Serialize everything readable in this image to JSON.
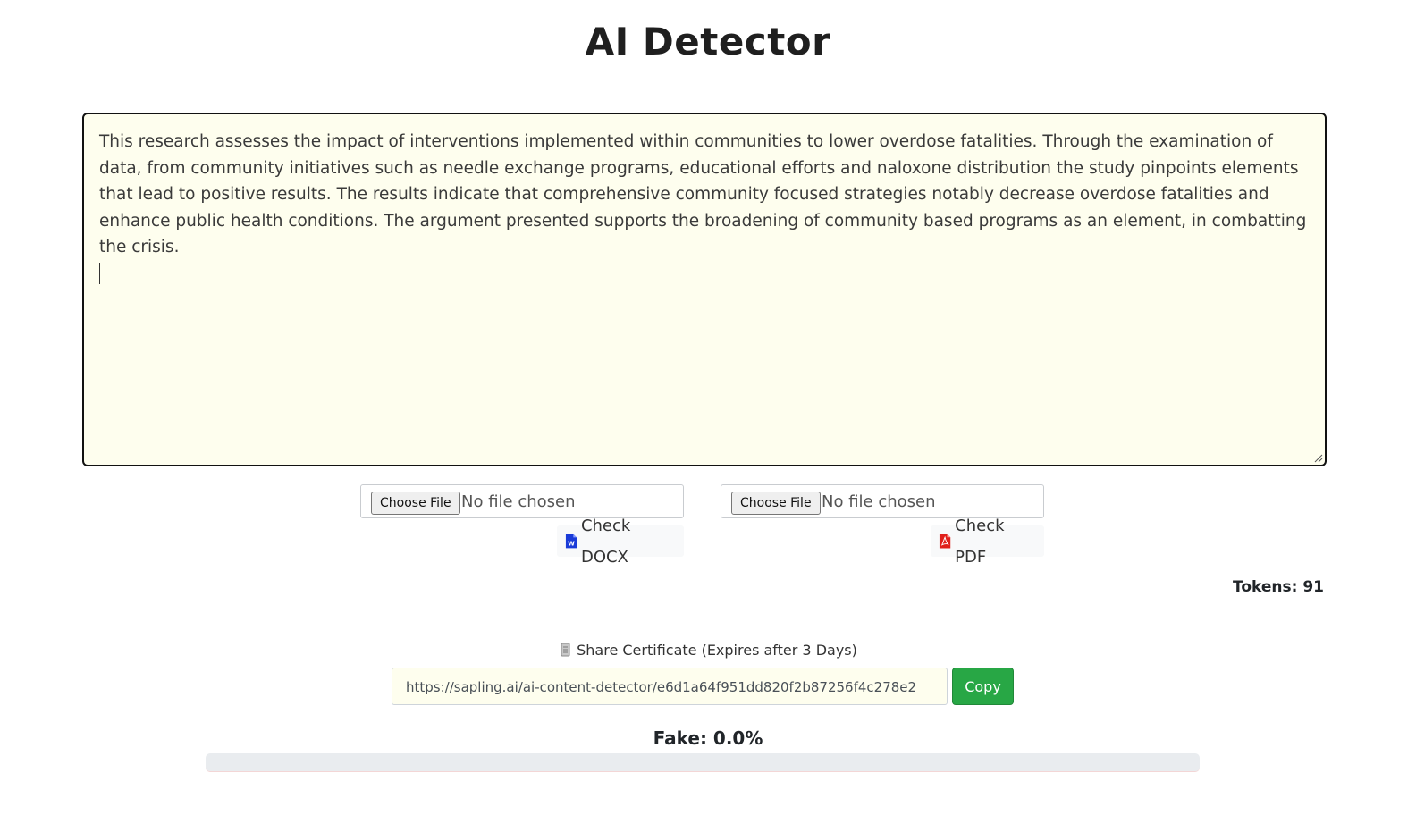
{
  "page": {
    "title": "AI Detector"
  },
  "editor": {
    "text": "This research assesses the impact of interventions implemented within communities to lower overdose fatalities. Through the examination of data, from community initiatives such as needle exchange programs, educational efforts and naloxone distribution the study pinpoints elements that lead to positive results. The results indicate that comprehensive community focused strategies notably decrease overdose fatalities and enhance public health conditions. The argument presented supports the broadening of community based programs as an element, in combatting the crisis."
  },
  "uploads": {
    "docx": {
      "choose_label": "Choose File",
      "status": "No file chosen",
      "check_label": "Check DOCX",
      "icon": "word-file-icon",
      "icon_color": "#1a3bd8"
    },
    "pdf": {
      "choose_label": "Choose File",
      "status": "No file chosen",
      "check_label": "Check PDF",
      "icon": "pdf-file-icon",
      "icon_color": "#e0201b"
    }
  },
  "tokens": {
    "label": "Tokens: 91"
  },
  "share": {
    "icon": "scroll-icon",
    "label": "Share Certificate (Expires after 3 Days)",
    "url": "https://sapling.ai/ai-content-detector/e6d1a64f951dd820f2b87256f4c278e2",
    "copy_label": "Copy",
    "copy_color": "#28a745"
  },
  "result": {
    "fake_label": "Fake: 0.0%",
    "fake_fraction": 0.0,
    "bar_color": "#dc3545",
    "track_color": "#e9ecef"
  }
}
